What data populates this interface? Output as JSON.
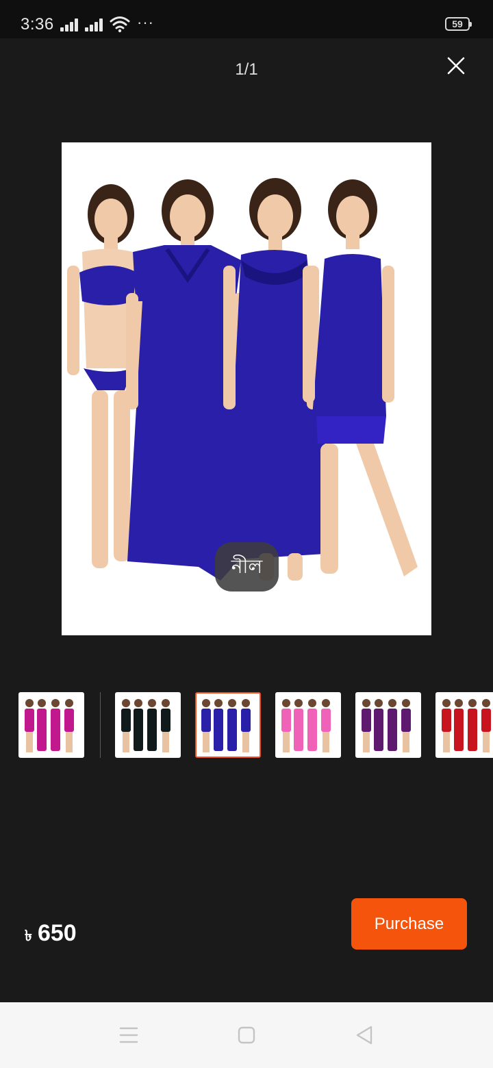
{
  "status_bar": {
    "time": "3:36",
    "battery_level": "59",
    "overflow_indicator": "···",
    "icons": [
      "signal-icon",
      "signal-icon",
      "wifi-icon",
      "battery-icon"
    ]
  },
  "viewer": {
    "page_counter": "1/1",
    "close_icon": "close-icon",
    "selected_color_label": "নীল",
    "image_background": "#ffffff",
    "product_color": "#2a1fa8"
  },
  "thumbnails": [
    {
      "color": "#c2188e",
      "selected": false
    },
    {
      "color": "#111a1a",
      "selected": false
    },
    {
      "color": "#2a1fa8",
      "selected": true
    },
    {
      "color": "#f062b8",
      "selected": false
    },
    {
      "color": "#5e1a6e",
      "selected": false
    },
    {
      "color": "#c8141e",
      "selected": false
    }
  ],
  "purchase": {
    "currency_symbol": "৳",
    "price": "650",
    "button_label": "Purchase",
    "accent_color": "#f5540c",
    "selected_border_color": "#f4511e"
  },
  "nav_bar": {
    "icons": [
      "menu-icon",
      "home-icon",
      "back-icon"
    ]
  }
}
